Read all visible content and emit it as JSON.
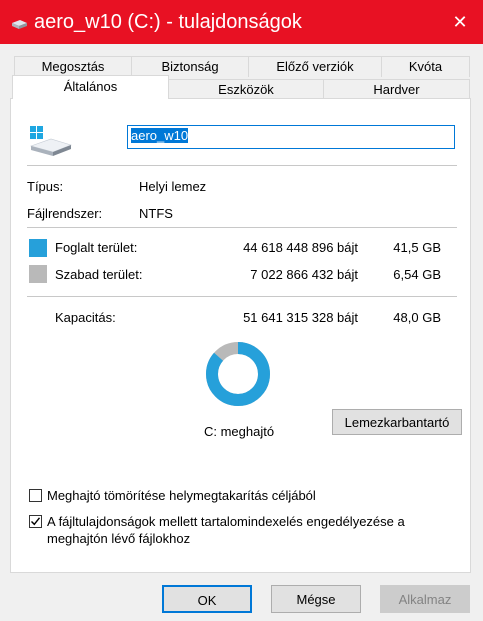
{
  "window": {
    "title": "aero_w10 (C:) - tulajdonságok",
    "close_symbol": "✕",
    "title_bar_color": "#e81123"
  },
  "tabs_row1": [
    {
      "label": "Megosztás"
    },
    {
      "label": "Biztonság"
    },
    {
      "label": "Előző verziók"
    },
    {
      "label": "Kvóta"
    }
  ],
  "tabs_row2": [
    {
      "label": "Általános",
      "active": true
    },
    {
      "label": "Eszközök"
    },
    {
      "label": "Hardver"
    }
  ],
  "general": {
    "drive_name": "aero_w10",
    "type_label": "Típus:",
    "type_value": "Helyi lemez",
    "fs_label": "Fájlrendszer:",
    "fs_value": "NTFS",
    "used_label": "Foglalt terület:",
    "used_bytes": "44 618 448 896 bájt",
    "used_size": "41,5 GB",
    "used_color": "#26a0da",
    "free_label": "Szabad terület:",
    "free_bytes": "7 022 866 432 bájt",
    "free_size": "6,54 GB",
    "free_color": "#b9b9b9",
    "capacity_label": "Kapacitás:",
    "capacity_bytes": "51 641 315 328 bájt",
    "capacity_size": "48,0 GB",
    "used_fraction": 0.864,
    "drive_label": "C: meghajtó",
    "cleanup_button": "Lemezkarbantartó",
    "compress_checkbox": {
      "label": "Meghajtó tömörítése helymegtakarítás céljából",
      "checked": false
    },
    "index_checkbox": {
      "label_line1": "A fájltulajdonságok mellett tartalomindexelés engedélyezése a",
      "label_line2": "meghajtón lévő fájlokhoz",
      "checked": true
    }
  },
  "footer": {
    "ok": "OK",
    "cancel": "Mégse",
    "apply": "Alkalmaz"
  }
}
